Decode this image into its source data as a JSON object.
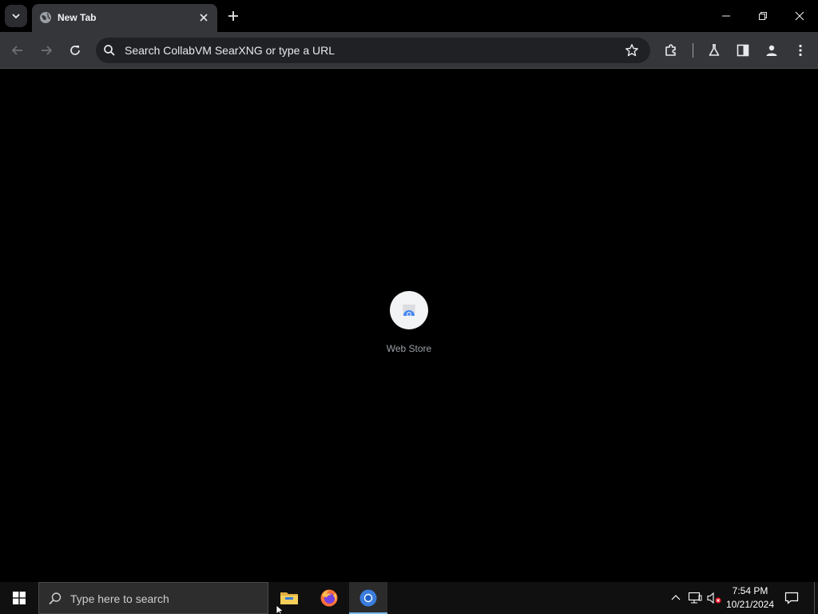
{
  "browser": {
    "tab": {
      "title": "New Tab"
    },
    "omnibox": {
      "placeholder": "Search CollabVM SearXNG or type a URL",
      "value": ""
    },
    "icons": {
      "tab_search": "chevron-down-icon",
      "favicon": "globe-icon",
      "tab_close": "close-icon",
      "new_tab": "plus-icon",
      "back": "arrow-left-icon",
      "forward": "arrow-right-icon",
      "reload": "reload-icon",
      "search": "search-icon",
      "bookmark": "star-icon",
      "extensions": "puzzle-icon",
      "labs": "flask-icon",
      "side_panel": "side-panel-icon",
      "profile": "person-icon",
      "menu": "kebab-menu-icon"
    }
  },
  "new_tab_page": {
    "shortcuts": [
      {
        "label": "Web Store",
        "icon": "web-store-icon"
      }
    ]
  },
  "taskbar": {
    "search_placeholder": "Type here to search",
    "apps": [
      {
        "name": "File Explorer",
        "icon": "folder-icon"
      },
      {
        "name": "Firefox",
        "icon": "firefox-icon"
      },
      {
        "name": "Chrome",
        "icon": "chrome-icon",
        "active": true
      }
    ],
    "clock": {
      "time": "7:54 PM",
      "date": "10/21/2024"
    }
  },
  "colors": {
    "toolbar": "#35363a",
    "omnibox": "#202124",
    "page_background": "#000000",
    "taskbar": "#101010",
    "active_app_indicator": "#76b9ed"
  }
}
